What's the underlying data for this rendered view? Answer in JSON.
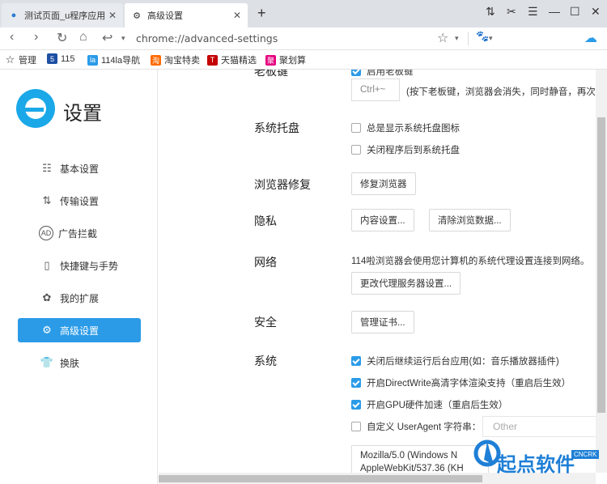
{
  "tabs": [
    {
      "label": "测试页面_u程序应用运行"
    },
    {
      "label": "高级设置"
    }
  ],
  "address": {
    "url": "chrome://advanced-settings"
  },
  "bookmarks": [
    {
      "label": "管理"
    },
    {
      "label": "115"
    },
    {
      "label": "114la导航"
    },
    {
      "label": "淘宝特卖"
    },
    {
      "label": "天猫精选"
    },
    {
      "label": "聚划算"
    }
  ],
  "sidebar": {
    "title": "设置",
    "items": [
      {
        "label": "基本设置"
      },
      {
        "label": "传输设置"
      },
      {
        "label": "广告拦截"
      },
      {
        "label": "快捷键与手势"
      },
      {
        "label": "我的扩展"
      },
      {
        "label": "高级设置"
      },
      {
        "label": "换肤"
      }
    ]
  },
  "main": {
    "boss_key": {
      "section": "老板键",
      "checkbox": "启用老板键",
      "key": "Ctrl+~",
      "hint": "(按下老板键，浏览器会消失，同时静音，再次按"
    },
    "tray": {
      "section": "系统托盘",
      "opt1": "总是显示系统托盘图标",
      "opt2": "关闭程序后到系统托盘"
    },
    "repair": {
      "section": "浏览器修复",
      "button": "修复浏览器"
    },
    "privacy": {
      "section": "隐私",
      "btn1": "内容设置...",
      "btn2": "清除浏览数据..."
    },
    "network": {
      "section": "网络",
      "desc": "114啦浏览器会使用您计算机的系统代理设置连接到网络。",
      "button": "更改代理服务器设置..."
    },
    "security": {
      "section": "安全",
      "button": "管理证书..."
    },
    "system": {
      "section": "系统",
      "opt1": "关闭后继续运行后台应用(如：音乐播放器插件)",
      "opt2": "开启DirectWrite高清字体渲染支持（重启后生效）",
      "opt3": "开启GPU硬件加速（重启后生效）",
      "opt4": "自定义 UserAgent 字符串：",
      "ua_placeholder": "Other",
      "ua_line1": "Mozilla/5.0 (Windows N",
      "ua_line2": "AppleWebKit/537.36 (KH"
    }
  },
  "watermark": {
    "text": "起点软件",
    "badge": "CNCRK"
  },
  "colors": {
    "accent": "#2b9be8",
    "logo": "#1aa8e8"
  }
}
